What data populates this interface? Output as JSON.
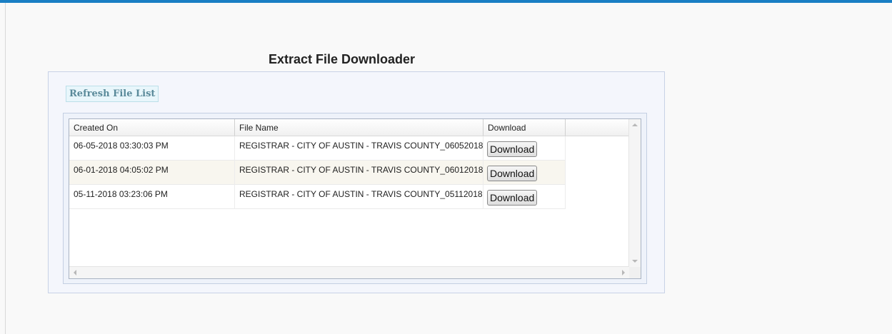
{
  "page": {
    "title": "Extract File Downloader"
  },
  "toolbar": {
    "refresh_label": "Refresh File List"
  },
  "grid": {
    "columns": [
      "Created On",
      "File Name",
      "Download"
    ],
    "rows": [
      {
        "created_on": "06-05-2018 03:30:03 PM",
        "file_name": "REGISTRAR - CITY OF AUSTIN - TRAVIS COUNTY_06052018",
        "download_label": "Download"
      },
      {
        "created_on": "06-01-2018 04:05:02 PM",
        "file_name": "REGISTRAR - CITY OF AUSTIN - TRAVIS COUNTY_06012018",
        "download_label": "Download"
      },
      {
        "created_on": "05-11-2018 03:23:06 PM",
        "file_name": "REGISTRAR - CITY OF AUSTIN - TRAVIS COUNTY_05112018",
        "download_label": "Download"
      }
    ]
  },
  "colors": {
    "accent": "#1a7fc4",
    "panel_background": "#f4f6fc",
    "alt_row": "#f8f6ef"
  },
  "icons": {
    "scroll_up": "chevron-up-icon",
    "scroll_down": "chevron-down-icon",
    "scroll_left": "chevron-left-icon",
    "scroll_right": "chevron-right-icon"
  }
}
